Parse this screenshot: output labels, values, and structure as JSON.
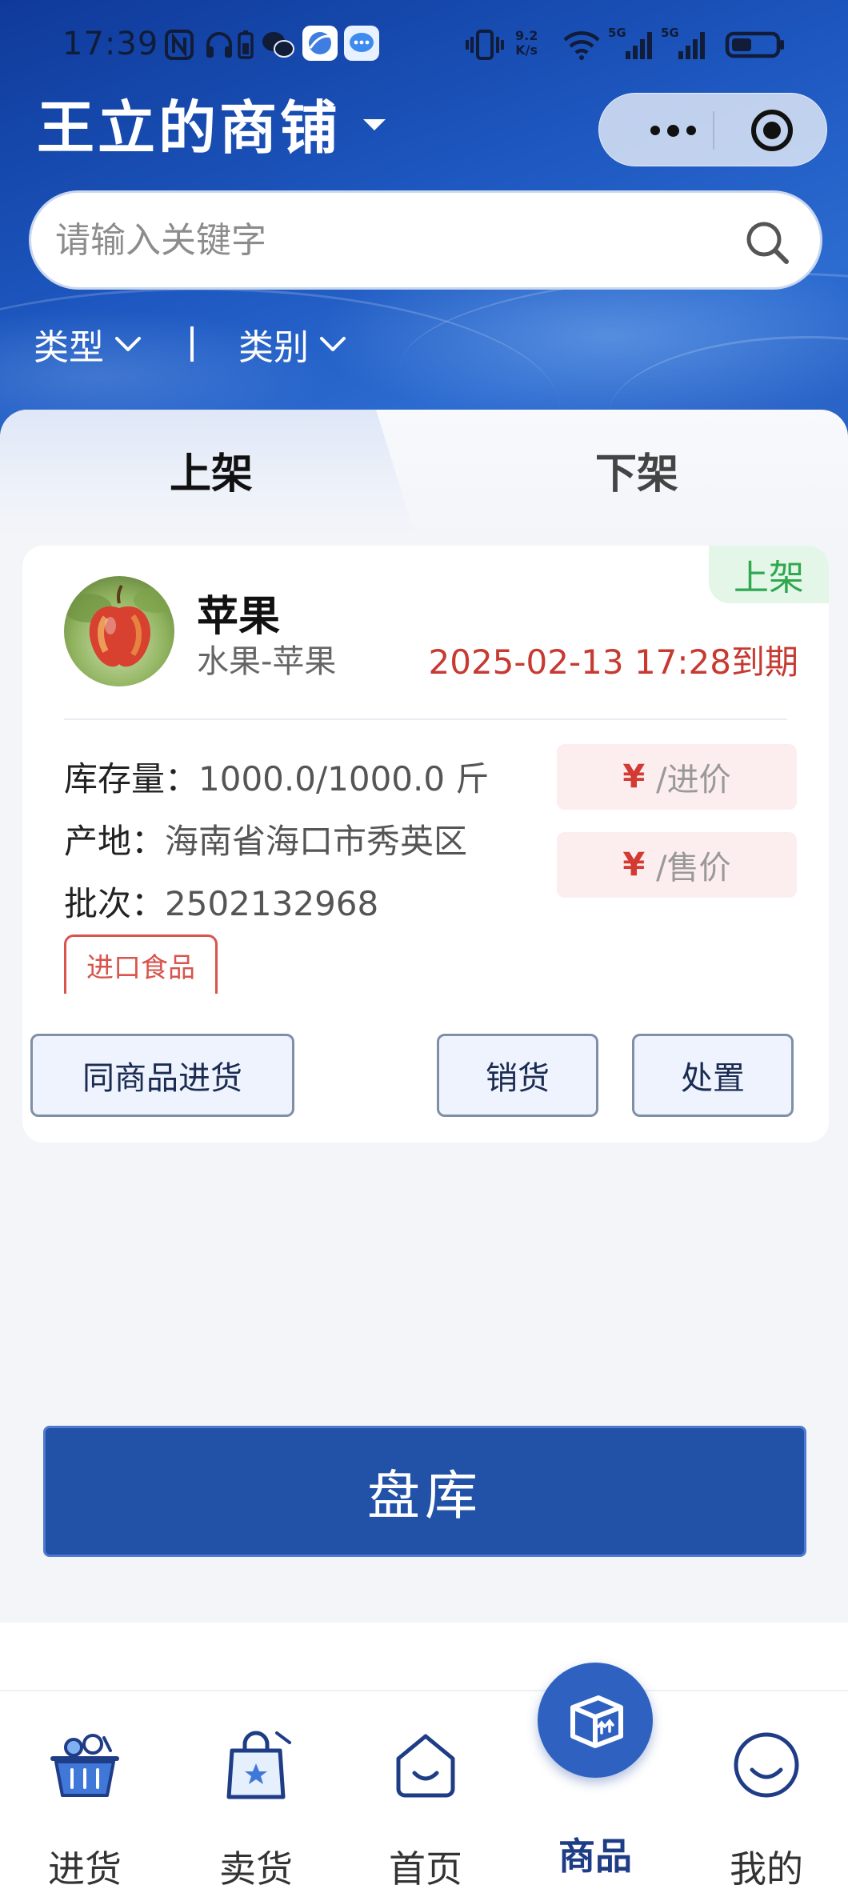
{
  "status_bar": {
    "time": "17:39",
    "net_speed_top": "9.2",
    "net_speed_bottom": "K/s",
    "sig1": "5G",
    "sig2": "5G"
  },
  "header": {
    "shop_title": "王立的商铺"
  },
  "search": {
    "placeholder": "请输入关键字"
  },
  "filters": {
    "type_label": "类型",
    "category_label": "类别"
  },
  "tabs": [
    {
      "label": "上架",
      "active": true
    },
    {
      "label": "下架",
      "active": false
    }
  ],
  "product": {
    "status": "上架",
    "name": "苹果",
    "category": "水果-苹果",
    "expire": "2025-02-13 17:28到期",
    "stock_label": "库存量：",
    "stock_value": "1000.0/1000.0 斤",
    "origin_label": "产地：",
    "origin_value": "海南省海口市秀英区",
    "batch_label": "批次：",
    "batch_value": "2502132968",
    "tag": "进口食品",
    "currency": "¥",
    "buy_price_suffix": "/进价",
    "sell_price_suffix": "/售价",
    "actions": {
      "restock": "同商品进货",
      "sell": "销货",
      "dispose": "处置"
    }
  },
  "inventory_button": "盘库",
  "nav": [
    {
      "label": "进货",
      "icon": "basket-icon"
    },
    {
      "label": "卖货",
      "icon": "shopping-bag-icon"
    },
    {
      "label": "首页",
      "icon": "home-icon"
    },
    {
      "label": "商品",
      "icon": "box-icon",
      "active": true
    },
    {
      "label": "我的",
      "icon": "smile-icon"
    }
  ],
  "colors": {
    "brand_blue": "#2251a8",
    "nav_active": "#1f3c86",
    "expire_red": "#c63a32",
    "status_green": "#2fa84f"
  }
}
